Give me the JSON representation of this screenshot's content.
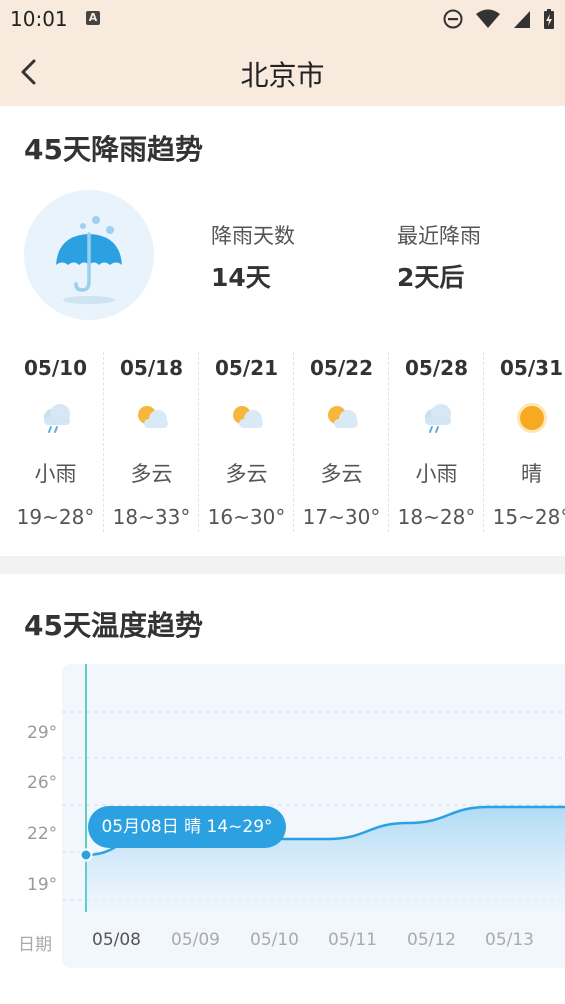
{
  "status_bar": {
    "time": "10:01",
    "notification_icon": "A",
    "icons": [
      "do-not-disturb-icon",
      "wifi-icon",
      "cell-signal-icon",
      "battery-charging-icon"
    ]
  },
  "header": {
    "title": "北京市",
    "back_icon": "chevron-left-icon"
  },
  "rain_trend": {
    "title": "45天降雨趋势",
    "icon": "umbrella-rain-icon",
    "rain_days_label": "降雨天数",
    "rain_days_value": "14天",
    "next_rain_label": "最近降雨",
    "next_rain_value": "2天后",
    "days": [
      {
        "date": "05/10",
        "icon": "light-rain-icon",
        "weather": "小雨",
        "temp": "19~28°"
      },
      {
        "date": "05/18",
        "icon": "partly-cloudy-icon",
        "weather": "多云",
        "temp": "18~33°"
      },
      {
        "date": "05/21",
        "icon": "partly-cloudy-icon",
        "weather": "多云",
        "temp": "16~30°"
      },
      {
        "date": "05/22",
        "icon": "partly-cloudy-icon",
        "weather": "多云",
        "temp": "17~30°"
      },
      {
        "date": "05/28",
        "icon": "light-rain-icon",
        "weather": "小雨",
        "temp": "18~28°"
      },
      {
        "date": "05/31",
        "icon": "sunny-icon",
        "weather": "晴",
        "temp": "15~28°"
      }
    ]
  },
  "temp_trend": {
    "title": "45天温度趋势",
    "x_axis_label": "日期",
    "tooltip": "05月08日 晴 14~29°",
    "colors": {
      "line": "#2ba1e2",
      "fill": "#bfe2f7",
      "tooltip": "#2ba1e2"
    }
  },
  "chart_data": {
    "type": "area",
    "title": "",
    "xlabel": "日期",
    "ylabel": "",
    "y_ticks": [
      "29°",
      "26°",
      "22°",
      "19°"
    ],
    "ylim": [
      16,
      32
    ],
    "x": [
      "05/08",
      "05/09",
      "05/10",
      "05/11",
      "05/12",
      "05/13"
    ],
    "series": [
      {
        "values": [
          21,
          23,
          22,
          22,
          23,
          24
        ]
      }
    ],
    "grid": true
  }
}
